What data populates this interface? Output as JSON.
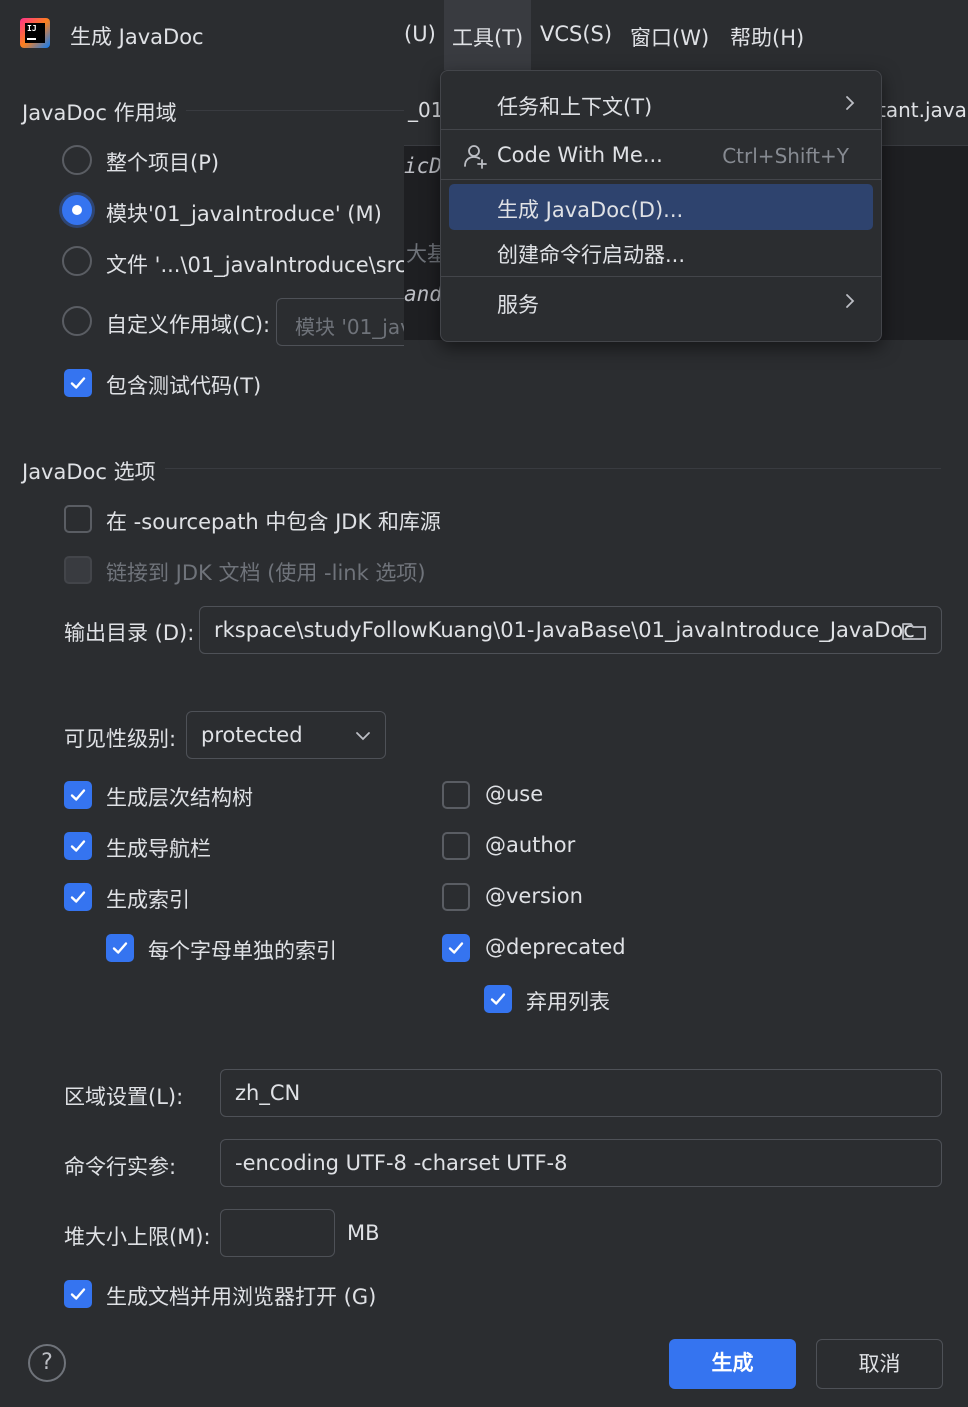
{
  "ide": {
    "menubar": [
      {
        "label": "(U)"
      },
      {
        "label": "工具(T)"
      },
      {
        "label": "VCS(S)"
      },
      {
        "label": "窗口(W)"
      },
      {
        "label": "帮助(H)"
      }
    ],
    "tab_fragments": [
      "_01",
      "tant.java"
    ],
    "code_fragments": [
      "icD",
      "大基",
      "and"
    ]
  },
  "tools_menu": {
    "items": [
      {
        "label": "任务和上下文(T)",
        "shortcut": "",
        "submenu": true,
        "icon": ""
      },
      {
        "label": "Code With Me...",
        "shortcut": "Ctrl+Shift+Y",
        "submenu": false,
        "icon": "user-plus-icon"
      },
      {
        "label": "生成 JavaDoc(D)...",
        "shortcut": "",
        "submenu": false,
        "selected": true
      },
      {
        "label": "创建命令行启动器...",
        "shortcut": "",
        "submenu": false
      },
      {
        "label": "服务",
        "shortcut": "",
        "submenu": true
      }
    ]
  },
  "dialog": {
    "title": "生成 JavaDoc",
    "scope": {
      "section_title": "JavaDoc 作用域",
      "whole_project": "整个项目(P)",
      "module": "模块'01_javaIntroduce' (M)",
      "file": "文件 '...\\01_javaIntroduce\\src\\",
      "custom": "自定义作用域(C):",
      "custom_placeholder": "模块 '01_jav",
      "include_tests": "包含测试代码(T)",
      "selected": "module"
    },
    "options": {
      "section_title": "JavaDoc 选项",
      "include_jdk_sourcepath": "在 -sourcepath 中包含 JDK 和库源",
      "link_jdk_docs": "链接到 JDK 文档 (使用 -link 选项)",
      "output_dir_label": "输出目录 (D):",
      "output_dir_value": "rkspace\\studyFollowKuang\\01-JavaBase\\01_javaIntroduce_JavaDoc",
      "visibility_label": "可见性级别:",
      "visibility_value": "protected",
      "hierarchy_tree": "生成层次结构树",
      "nav_bar": "生成导航栏",
      "index": "生成索引",
      "per_letter_index": "每个字母单独的索引",
      "tag_use": "@use",
      "tag_author": "@author",
      "tag_version": "@version",
      "tag_deprecated": "@deprecated",
      "deprecated_list": "弃用列表",
      "locale_label": "区域设置(L):",
      "locale_value": "zh_CN",
      "cmd_args_label": "命令行实参:",
      "cmd_args_value": "-encoding UTF-8 -charset UTF-8",
      "heap_label": "堆大小上限(M):",
      "heap_value": "",
      "heap_unit": "MB",
      "open_browser": "生成文档并用浏览器打开 (G)"
    },
    "help_label": "?",
    "generate_button": "生成",
    "cancel_button": "取消",
    "accent_color": "#3574f0"
  }
}
